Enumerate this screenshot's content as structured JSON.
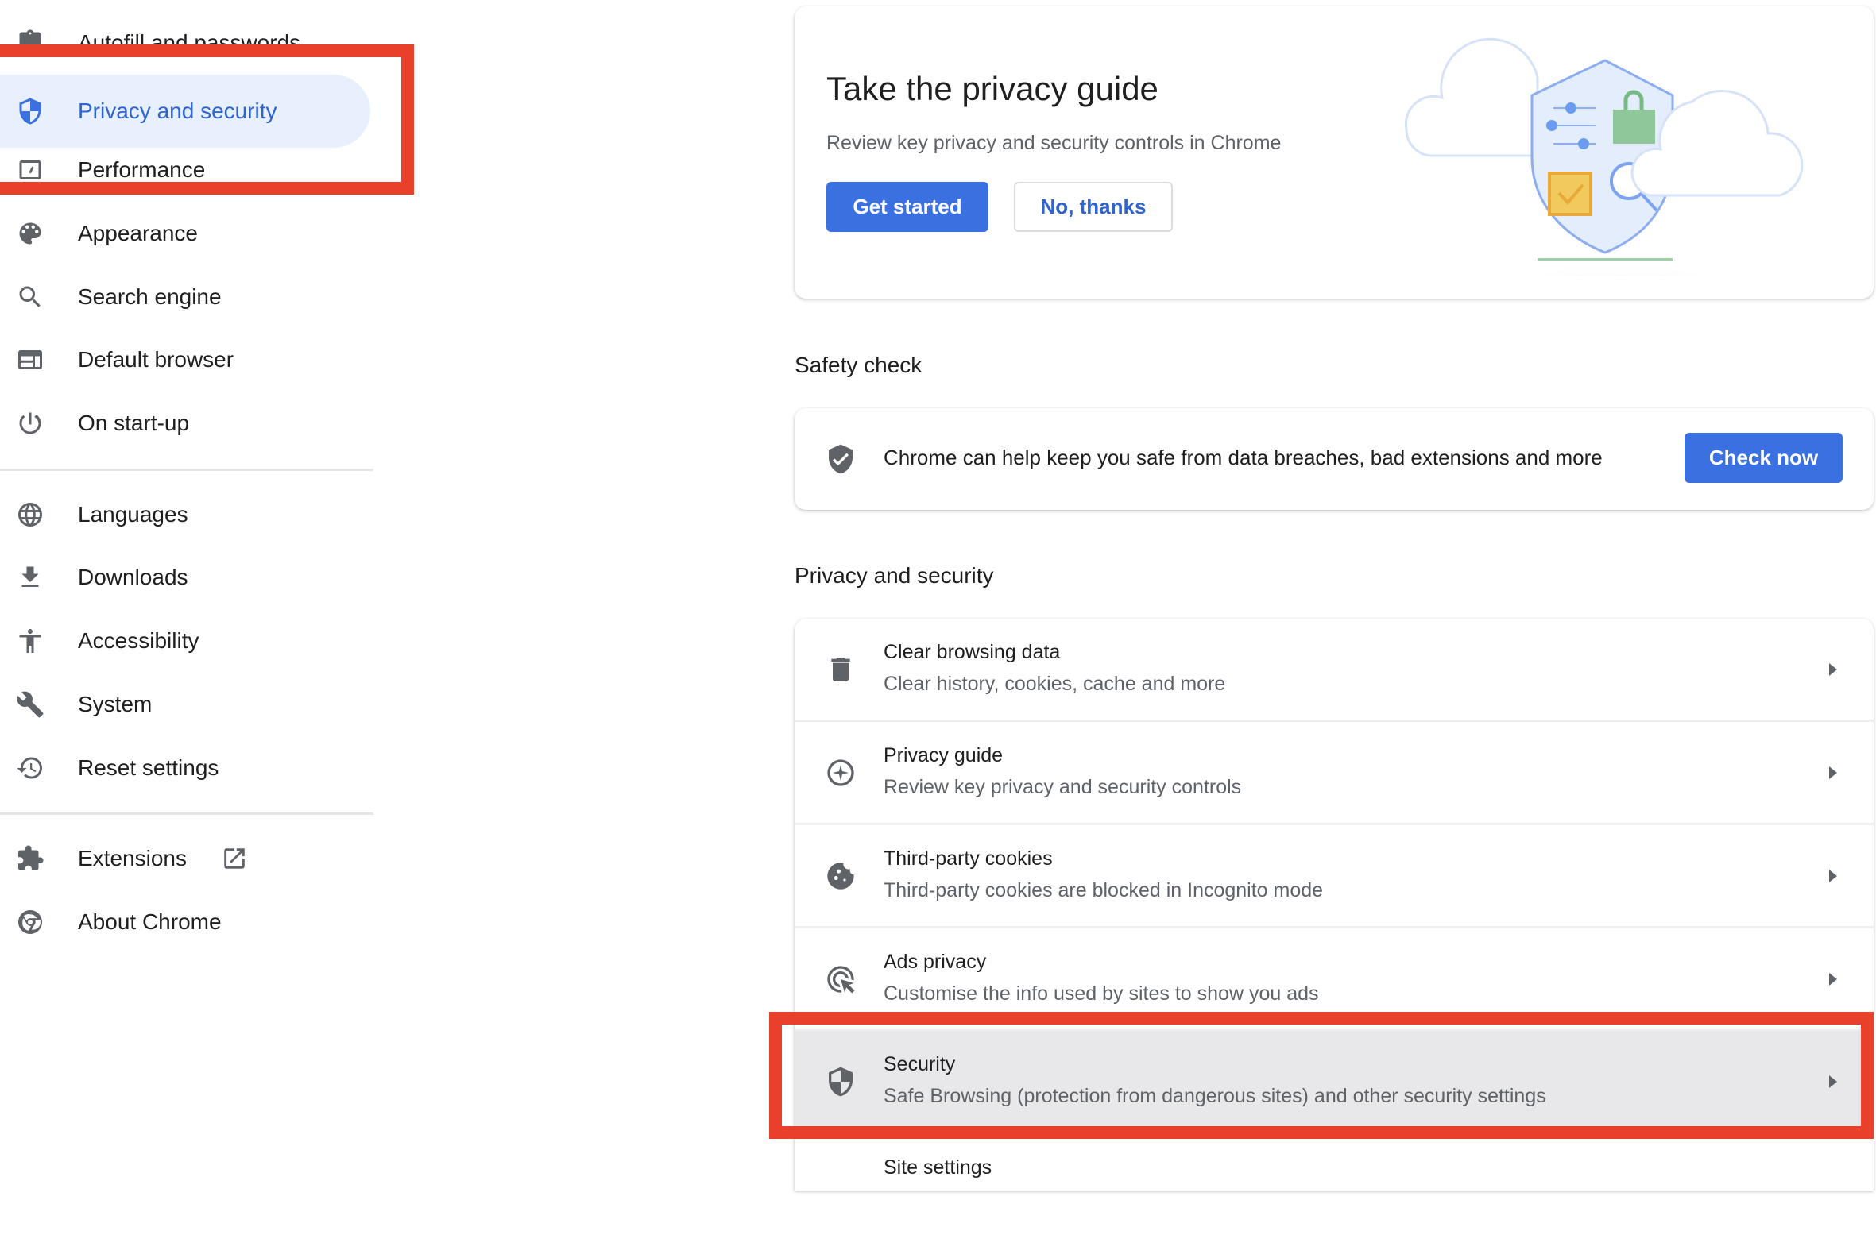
{
  "sidebar": {
    "items": [
      {
        "label": "Autofill and passwords",
        "icon": "clipboard-icon"
      },
      {
        "label": "Privacy and security",
        "icon": "shield-icon",
        "active": true
      },
      {
        "label": "Performance",
        "icon": "speedometer-icon"
      },
      {
        "label": "Appearance",
        "icon": "palette-icon"
      },
      {
        "label": "Search engine",
        "icon": "search-icon"
      },
      {
        "label": "Default browser",
        "icon": "browser-window-icon"
      },
      {
        "label": "On start-up",
        "icon": "power-icon"
      },
      {
        "label": "Languages",
        "icon": "globe-icon"
      },
      {
        "label": "Downloads",
        "icon": "download-icon"
      },
      {
        "label": "Accessibility",
        "icon": "accessibility-icon"
      },
      {
        "label": "System",
        "icon": "wrench-icon"
      },
      {
        "label": "Reset settings",
        "icon": "history-icon"
      },
      {
        "label": "Extensions",
        "icon": "puzzle-icon",
        "external_link_icon": "open-in-new-icon"
      },
      {
        "label": "About Chrome",
        "icon": "chrome-icon"
      }
    ]
  },
  "privacy_guide_card": {
    "title": "Take the privacy guide",
    "description": "Review key privacy and security controls in Chrome",
    "primary_button": "Get started",
    "secondary_button": "No, thanks",
    "illustration": "privacy-shield-illustration"
  },
  "safety_check": {
    "heading": "Safety check",
    "text": "Chrome can help keep you safe from data breaches, bad extensions and more",
    "button": "Check now",
    "icon": "shield-check-icon"
  },
  "privacy_section": {
    "heading": "Privacy and security",
    "rows": [
      {
        "title": "Clear browsing data",
        "subtitle": "Clear history, cookies, cache and more",
        "icon": "trash-icon"
      },
      {
        "title": "Privacy guide",
        "subtitle": "Review key privacy and security controls",
        "icon": "compass-icon"
      },
      {
        "title": "Third-party cookies",
        "subtitle": "Third-party cookies are blocked in Incognito mode",
        "icon": "cookie-icon"
      },
      {
        "title": "Ads privacy",
        "subtitle": "Customise the info used by sites to show you ads",
        "icon": "ads-target-icon"
      },
      {
        "title": "Security",
        "subtitle": "Safe Browsing (protection from dangerous sites) and other security settings",
        "icon": "shield-icon",
        "highlighted": true
      },
      {
        "title": "Site settings",
        "subtitle": "",
        "icon": "site-settings-icon"
      }
    ]
  },
  "colors": {
    "accent": "#3a70e0",
    "active_nav_bg": "#e8f0fd",
    "active_nav_text": "#2f63cf",
    "annotation_red": "#e8402a",
    "highlight_row_bg": "#e8e8ea"
  }
}
